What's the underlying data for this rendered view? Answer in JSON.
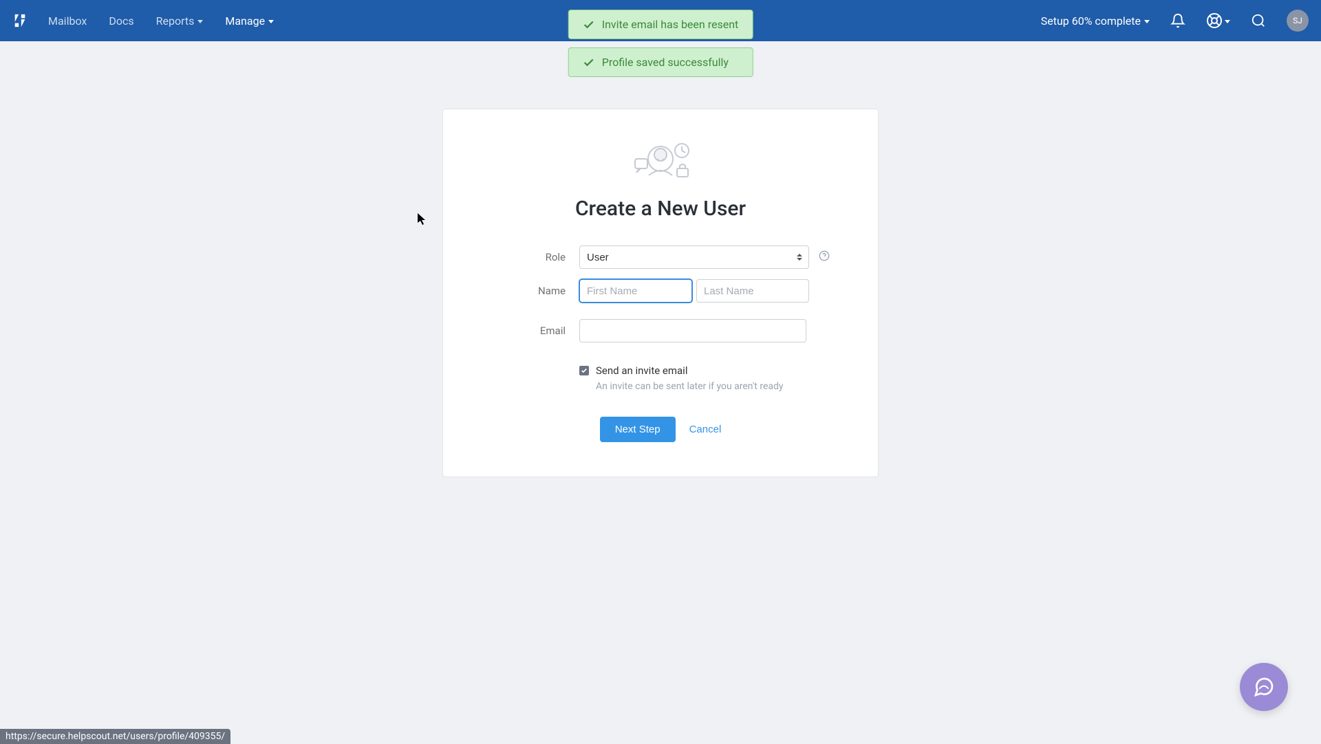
{
  "nav": {
    "mailbox": "Mailbox",
    "docs": "Docs",
    "reports": "Reports",
    "manage": "Manage"
  },
  "setup_status": "Setup 60% complete",
  "avatar_initials": "SJ",
  "toasts": {
    "resent": "Invite email has been resent",
    "saved": "Profile saved successfully"
  },
  "card": {
    "title": "Create a New User",
    "labels": {
      "role": "Role",
      "name": "Name",
      "email": "Email"
    },
    "role_value": "User",
    "placeholders": {
      "first_name": "First Name",
      "last_name": "Last Name"
    },
    "checkbox": {
      "label": "Send an invite email",
      "hint": "An invite can be sent later if you aren't ready",
      "checked": true
    },
    "buttons": {
      "next": "Next Step",
      "cancel": "Cancel"
    }
  },
  "url_preview": "https://secure.helpscout.net/users/profile/409355/"
}
